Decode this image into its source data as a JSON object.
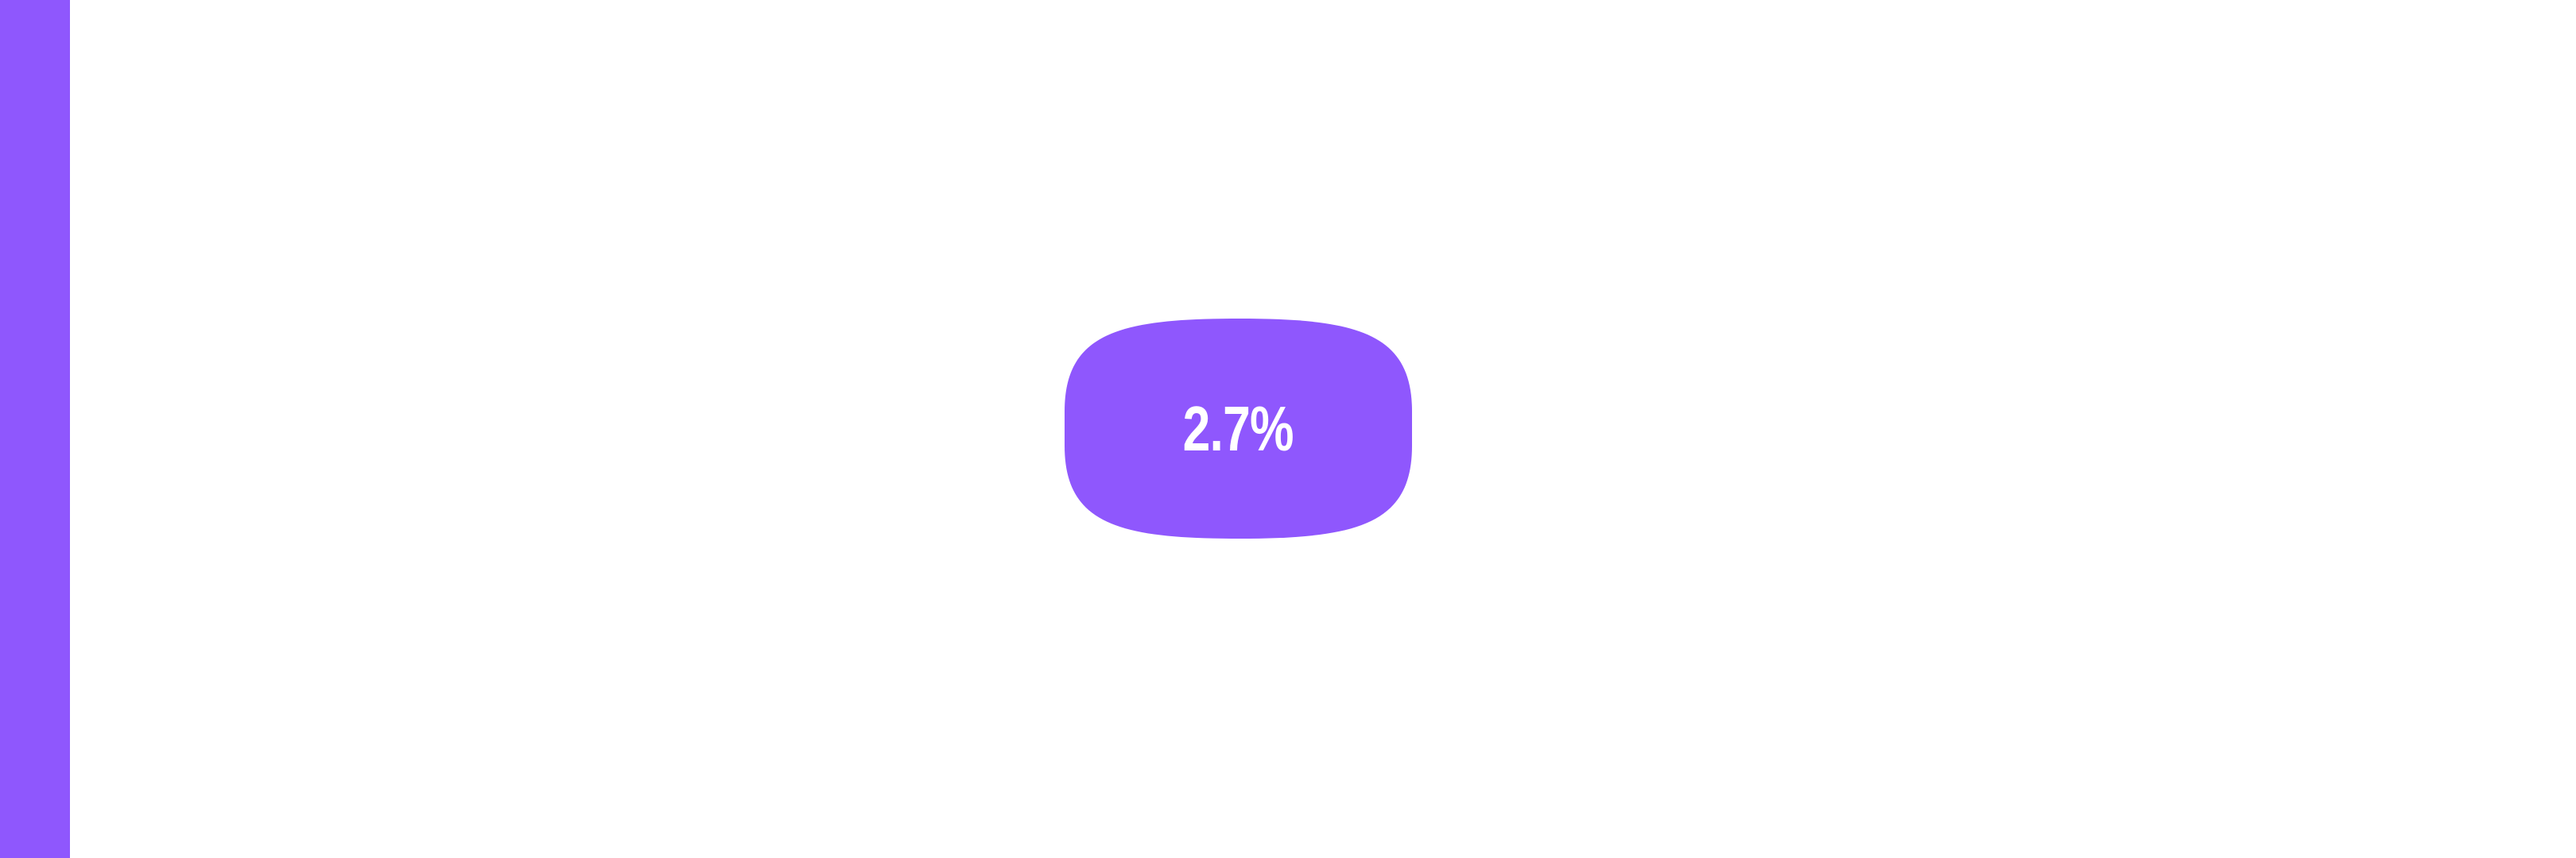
{
  "colors": {
    "accent": "#8f57fd",
    "background": "#ffffff",
    "text_on_accent": "#ffffff"
  },
  "badge": {
    "value": "2.7%"
  }
}
